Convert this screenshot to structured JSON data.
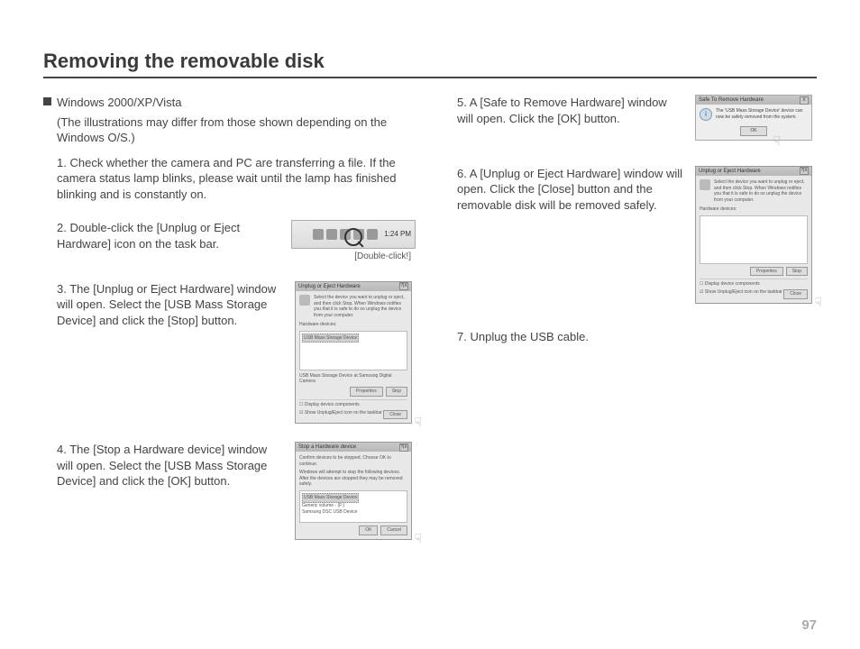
{
  "title": "Removing the removable disk",
  "bullet_heading": "Windows 2000/XP/Vista",
  "bullet_note": "(The illustrations may differ from those shown depending on the Windows O/S.)",
  "steps_left": [
    {
      "num": "1.",
      "text": "Check whether the camera and PC are transferring a file. If the camera status lamp blinks, please wait until the lamp has finished blinking and is constantly on."
    },
    {
      "num": "2.",
      "text": "Double-click the [Unplug or Eject Hardware] icon on the task bar.",
      "caption": "[Double-click!]",
      "time": "1:24 PM"
    },
    {
      "num": "3.",
      "text": "The [Unplug or Eject Hardware] window will open. Select the [USB Mass Storage Device] and click the [Stop] button.",
      "dlg_title": "Unplug or Eject Hardware",
      "dlg_desc": "Select the device you want to unplug or eject, and then click Stop. When Windows notifies you that it is safe to do so unplug the device from your computer.",
      "dlg_section": "Hardware devices:",
      "dlg_item": "USB Mass Storage Device",
      "dlg_subtext": "USB Mass Storage Device at Samsung Digital Camera",
      "dlg_btn1": "Properties",
      "dlg_btn2": "Stop",
      "dlg_chk1": "Display device components",
      "dlg_chk2": "Show Unplug/Eject icon on the taskbar",
      "dlg_close": "Close"
    },
    {
      "num": "4.",
      "text": "The [Stop a Hardware device] window will open. Select the [USB Mass Storage Device] and click the [OK] button.",
      "dlg_title": "Stop a Hardware device",
      "dlg_desc1": "Confirm devices to be stopped, Choose OK to continue.",
      "dlg_desc2": "Windows will attempt to stop the following devices. After the devices are stopped they may be removed safely.",
      "dlg_item1": "USB Mass Storage Device",
      "dlg_item2": "Generic volume - (F:)",
      "dlg_item3": "Samsung DSC USB Device",
      "dlg_btn1": "OK",
      "dlg_btn2": "Cancel"
    }
  ],
  "steps_right": [
    {
      "num": "5.",
      "text": "A [Safe to Remove Hardware] window will open. Click the [OK] button.",
      "dlg_title": "Safe To Remove Hardware",
      "dlg_msg": "The 'USB Mass Storage Device' device can now be safely removed from the system.",
      "dlg_btn": "OK"
    },
    {
      "num": "6.",
      "text": "A [Unplug or Eject Hardware] window will open. Click the [Close] button and the removable disk will be removed safely.",
      "dlg_title": "Unplug or Eject Hardware",
      "dlg_desc": "Select the device you want to unplug or eject, and then click Stop. When Windows notifies you that it is safe to do so unplug the device from your computer.",
      "dlg_section": "Hardware devices:",
      "dlg_btn1": "Properties",
      "dlg_btn2": "Stop",
      "dlg_chk1": "Display device components",
      "dlg_chk2": "Show Unplug/Eject icon on the taskbar",
      "dlg_close": "Close"
    },
    {
      "num": "7.",
      "text": "Unplug the USB cable."
    }
  ],
  "page_number": "97"
}
